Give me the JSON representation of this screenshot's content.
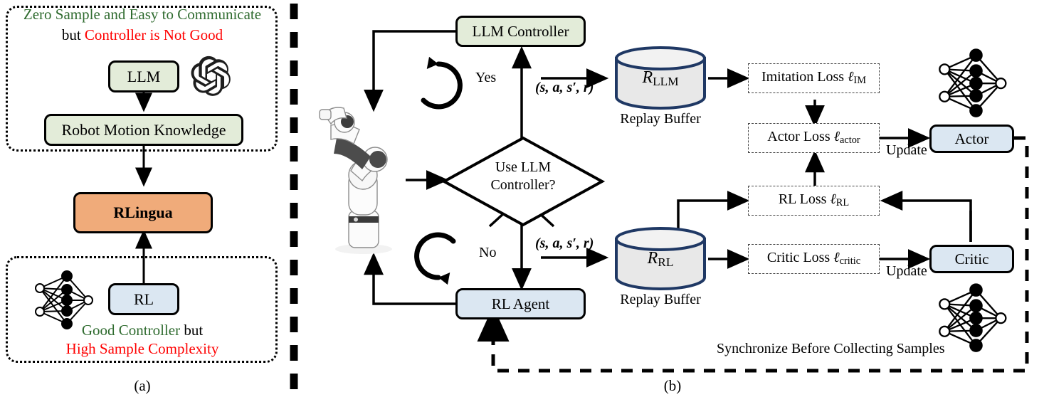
{
  "figure": {
    "panel_a_caption": "(a)",
    "panel_b_caption": "(b)"
  },
  "panel_a": {
    "llm_group": {
      "line1": "Zero Sample and Easy to Communicate",
      "line2_prefix": "but ",
      "line2_red": "Controller is Not Good",
      "boxes": [
        {
          "label": "LLM",
          "color": "#e3ecd9"
        },
        {
          "label": "Robot Motion Knowledge",
          "color": "#e3ecd9"
        }
      ],
      "logo": "openai-logo"
    },
    "center_box": {
      "label": "RLingua",
      "color": "#f0ab7a"
    },
    "rl_group": {
      "box": {
        "label": "RL",
        "color": "#dbe7f2"
      },
      "line1_green": "Good Controller",
      "line1_suffix": " but",
      "line2_red": "High Sample Complexity",
      "icon": "neural-network-icon"
    }
  },
  "panel_b": {
    "llm_controller": {
      "label": "LLM Controller",
      "color": "#e3ecd9"
    },
    "rl_agent": {
      "label": "RL Agent",
      "color": "#dbe7f2"
    },
    "decision": {
      "line1": "Use LLM",
      "line2": "Controller?"
    },
    "branch_yes": "Yes",
    "branch_no": "No",
    "transition_tuple": "(s, a, s', r)",
    "buffers": [
      {
        "symbol": "R",
        "subscript": "LLM",
        "caption": "Replay Buffer"
      },
      {
        "symbol": "R",
        "subscript": "RL",
        "caption": "Replay Buffer"
      }
    ],
    "losses": [
      {
        "name": "Imitation Loss",
        "symbol": "ℓ",
        "subscript": "IM"
      },
      {
        "name": "Actor Loss",
        "symbol": "ℓ",
        "subscript": "actor"
      },
      {
        "name": "RL Loss",
        "symbol": "ℓ",
        "subscript": "RL"
      },
      {
        "name": "Critic Loss",
        "symbol": "ℓ",
        "subscript": "critic"
      }
    ],
    "networks": [
      {
        "label": "Actor",
        "color": "#dbe7f2"
      },
      {
        "label": "Critic",
        "color": "#dbe7f2"
      }
    ],
    "update_labels": [
      "Update",
      "Update"
    ],
    "sync_label": "Synchronize Before Collecting Samples",
    "robot_icon": "robot-arm-photo",
    "loop_icons": [
      "circular-arrow-icon",
      "circular-arrow-icon"
    ],
    "nn_icons": [
      "neural-network-icon",
      "neural-network-icon"
    ]
  },
  "colors": {
    "green_fill": "#e3ecd9",
    "blue_fill": "#dbe7f2",
    "orange_fill": "#f0ab7a",
    "cylinder_stroke": "#1f3864",
    "cylinder_fill": "#e8e8e8",
    "green_text": "#2f6b2f",
    "red_text": "#ff0000",
    "stroke": "#000000"
  }
}
